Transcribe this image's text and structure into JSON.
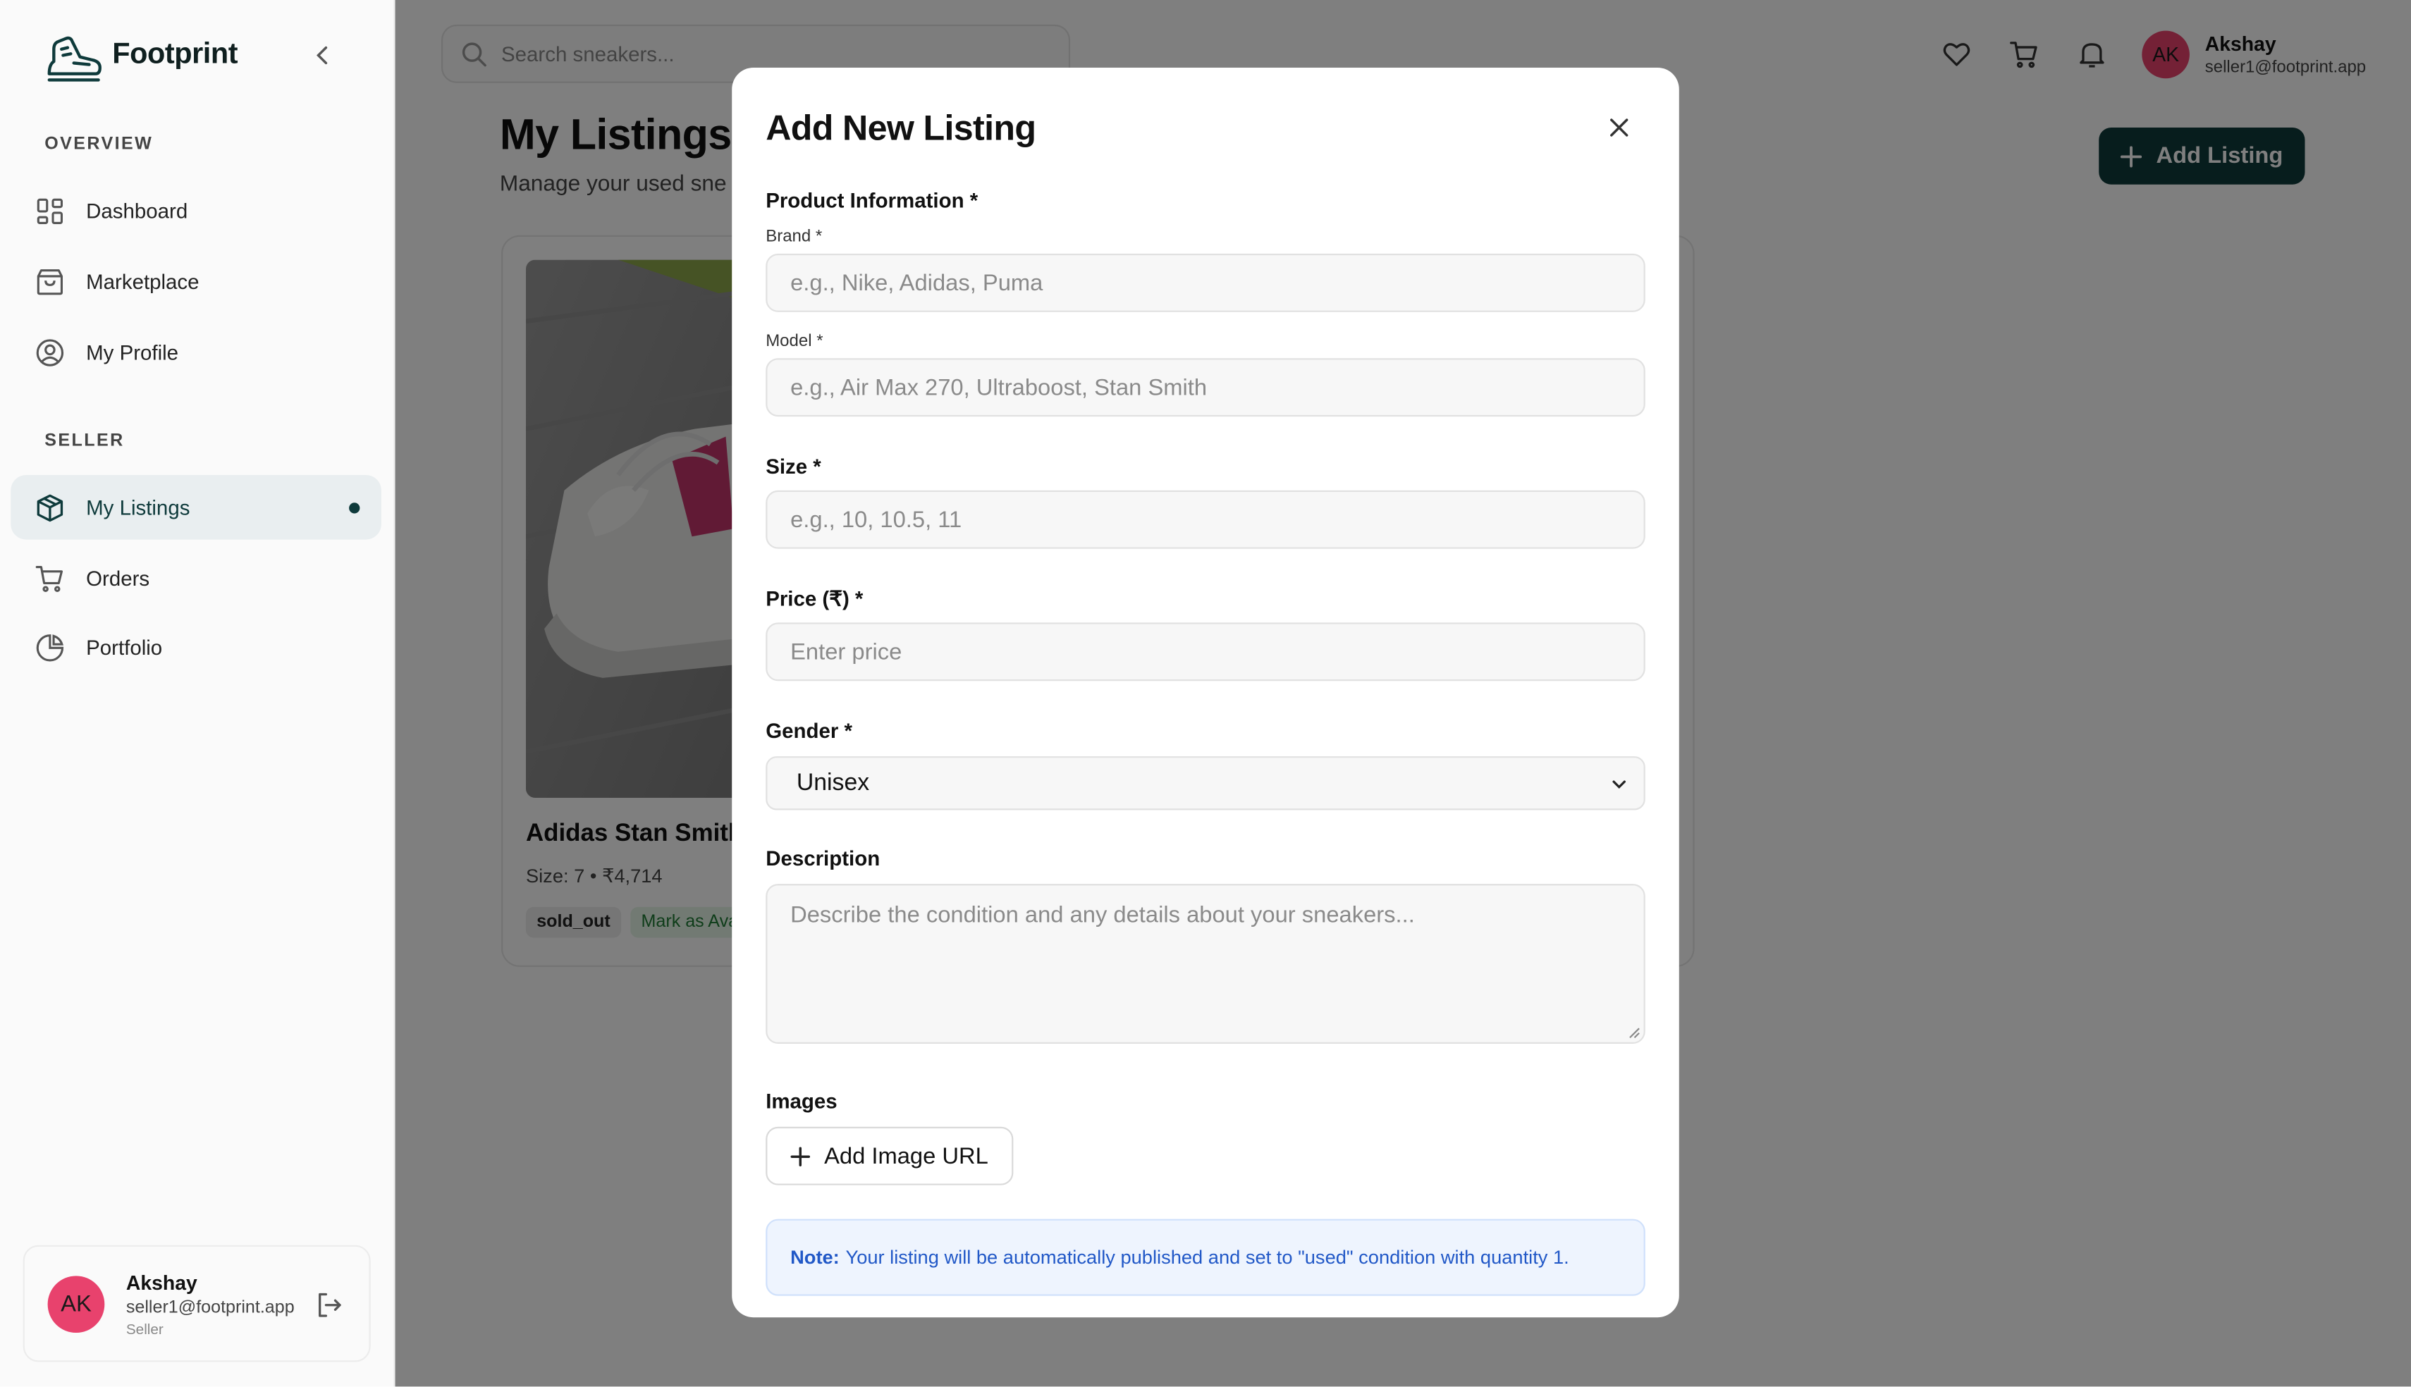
{
  "app": {
    "name": "Footprint"
  },
  "sidebar": {
    "sections": [
      {
        "title": "OVERVIEW",
        "items": [
          {
            "label": "Dashboard",
            "icon": "dashboard-grid-icon"
          },
          {
            "label": "Marketplace",
            "icon": "shopping-bag-icon"
          },
          {
            "label": "My Profile",
            "icon": "user-circle-icon"
          }
        ]
      },
      {
        "title": "SELLER",
        "items": [
          {
            "label": "My Listings",
            "icon": "package-icon",
            "active": true
          },
          {
            "label": "Orders",
            "icon": "cart-icon"
          },
          {
            "label": "Portfolio",
            "icon": "pie-chart-icon"
          }
        ]
      }
    ],
    "user": {
      "initials": "AK",
      "name": "Akshay",
      "email": "seller1@footprint.app",
      "role": "Seller"
    }
  },
  "header": {
    "search_placeholder": "Search sneakers...",
    "user": {
      "initials": "AK",
      "name": "Akshay",
      "email": "seller1@footprint.app"
    }
  },
  "main": {
    "title": "My Listings",
    "subtitle": "Manage your used sne",
    "add_button": "Add Listing",
    "listing": {
      "name": "Adidas Stan Smith",
      "meta": "Size: 7 • ₹4,714",
      "status": "sold_out",
      "action": "Mark as Ava"
    }
  },
  "modal": {
    "title": "Add New Listing",
    "product_section": "Product Information *",
    "brand": {
      "label": "Brand *",
      "placeholder": "e.g., Nike, Adidas, Puma"
    },
    "model": {
      "label": "Model *",
      "placeholder": "e.g., Air Max 270, Ultraboost, Stan Smith"
    },
    "size": {
      "label": "Size *",
      "placeholder": "e.g., 10, 10.5, 11"
    },
    "price": {
      "label": "Price (₹) *",
      "placeholder": "Enter price"
    },
    "gender": {
      "label": "Gender *",
      "value": "Unisex"
    },
    "description": {
      "label": "Description",
      "placeholder": "Describe the condition and any details about your sneakers..."
    },
    "images": {
      "label": "Images",
      "button": "Add Image URL"
    },
    "note": {
      "prefix": "Note:",
      "text": "Your listing will be automatically published and set to \"used\" condition with quantity 1."
    }
  },
  "colors": {
    "brand": "#0f3a3b",
    "avatar": "#e8426d",
    "note_text": "#2158c7",
    "sold_out_badge": "#ededed",
    "action_badge": "#e4f4e6"
  }
}
